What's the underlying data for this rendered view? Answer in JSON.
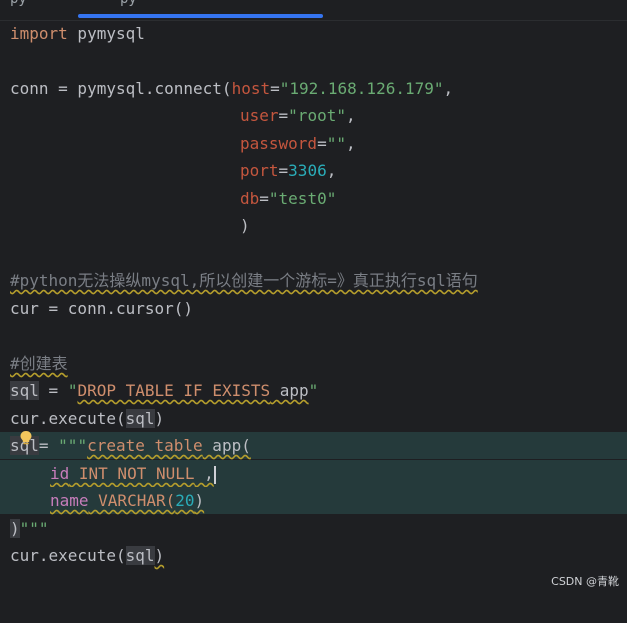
{
  "tabs": {
    "left_text": "py",
    "active_text": "py"
  },
  "code": {
    "l1_import": "import",
    "l1_mod": " pymysql",
    "l3_conn": "conn = pymysql.connect(",
    "l3_host_k": "host",
    "l3_eq": "=",
    "l3_host_v": "\"192.168.126.179\"",
    "l3_comma": ",",
    "l4_user_k": "user",
    "l4_user_v": "\"root\"",
    "l5_pw_k": "password",
    "l5_pw_v": "\"\"",
    "l6_port_k": "port",
    "l6_port_v": "3306",
    "l7_db_k": "db",
    "l7_db_v": "\"test0\"",
    "l8_close": ")",
    "l10_comment": "#python无法操纵mysql,所以创建一个游标=》真正执行sql语句",
    "l11_cur": "cur = conn.cursor()",
    "l13_comment": "#创建表",
    "l14_sql": "sql",
    "l14_eq": " = ",
    "l14_q1": "\"",
    "l14_drop": "DROP TABLE IF EXISTS",
    "l14_app": " app",
    "l14_q2": "\"",
    "l15_exec": "cur.execute(",
    "l15_sql": "sql",
    "l15_close": ")",
    "l16_sql": "sql",
    "l16_eq": "= ",
    "l16_triple": "\"\"\"",
    "l16_create": "create table",
    "l16_app": " app(",
    "l17_id": "id",
    "l17_type": " INT NOT NULL",
    "l17_comma": " ,",
    "l18_name": "name",
    "l18_type": " VARCHAR(",
    "l18_num": "20",
    "l18_close": ")",
    "l19_close": ")",
    "l19_triple": "\"\"\"",
    "l20_exec": "cur.execute(",
    "l20_sql": "sql",
    "l20_close": ")"
  },
  "watermark": "CSDN @青靴",
  "icons": {
    "intention": "lightbulb-icon"
  },
  "colors": {
    "background": "#1e1f22",
    "keyword": "#cf8e6d",
    "string": "#6aab73",
    "number": "#2aacb8",
    "kwarg": "#c4563e",
    "comment": "#7a7e85",
    "tab_underline": "#3574f0",
    "highlight": "#253a3b"
  }
}
